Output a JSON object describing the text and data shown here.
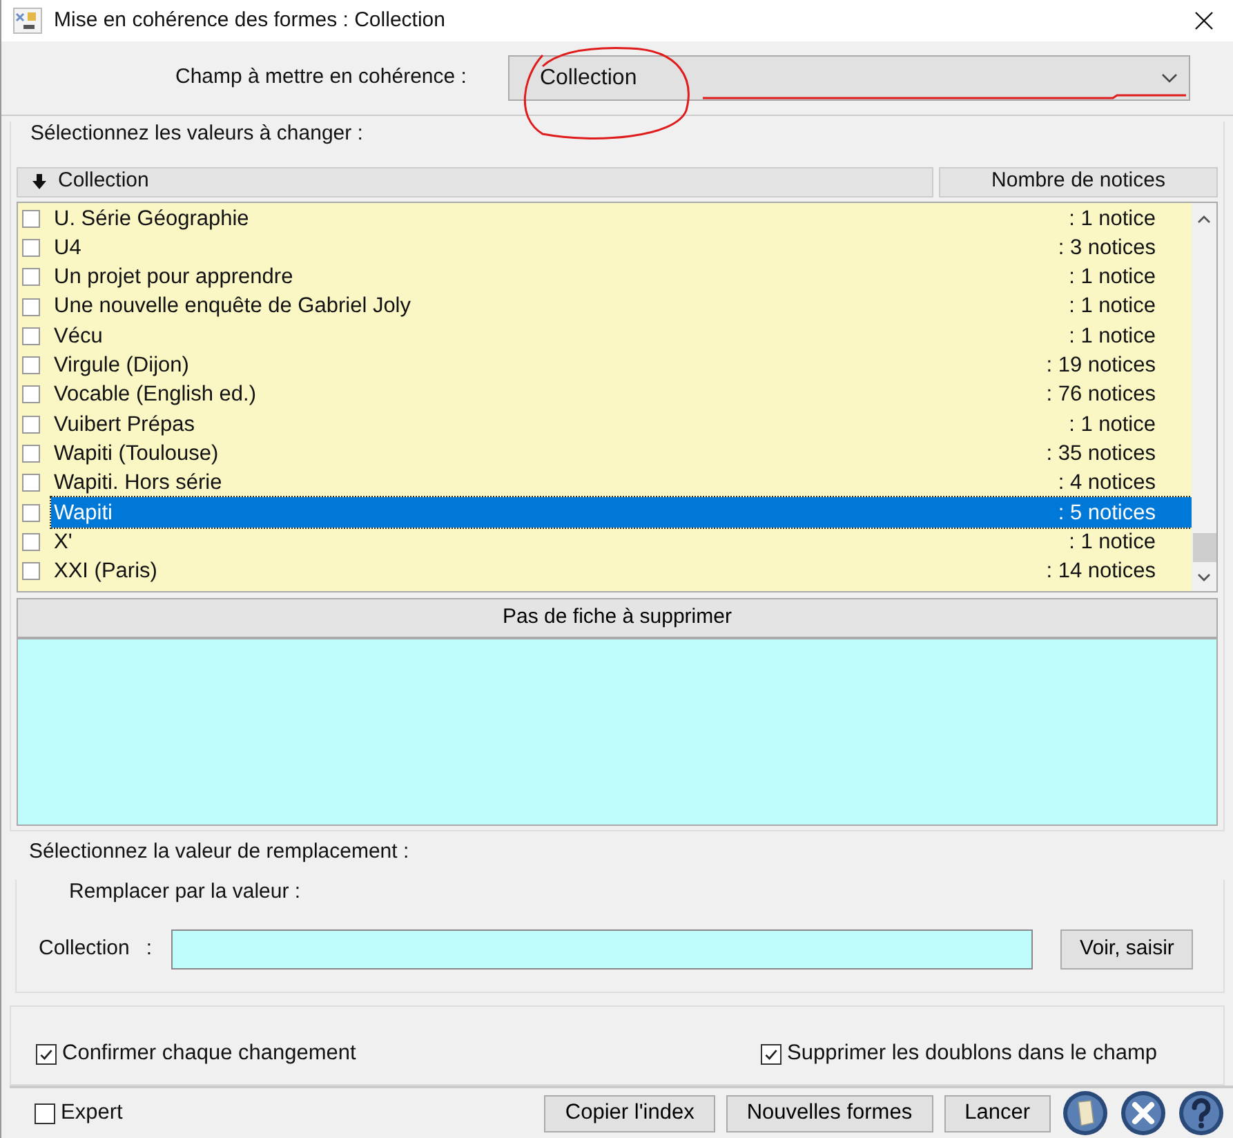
{
  "window": {
    "title": "Mise en cohérence des formes :  Collection"
  },
  "field_selector": {
    "label": "Champ à mettre en cohérence :",
    "value": "Collection"
  },
  "values_group": {
    "title": "Sélectionnez les valeurs à changer :",
    "columns": [
      "Collection",
      "Nombre de notices"
    ],
    "rows": [
      {
        "label": "U. Série Géographie",
        "count": ": 1 notice",
        "checked": false,
        "selected": false
      },
      {
        "label": "U4",
        "count": ": 3 notices",
        "checked": false,
        "selected": false
      },
      {
        "label": "Un projet pour apprendre",
        "count": ": 1 notice",
        "checked": false,
        "selected": false
      },
      {
        "label": "Une nouvelle enquête de Gabriel Joly",
        "count": ": 1 notice",
        "checked": false,
        "selected": false
      },
      {
        "label": "Vécu",
        "count": ": 1 notice",
        "checked": false,
        "selected": false
      },
      {
        "label": "Virgule (Dijon)",
        "count": ": 19 notices",
        "checked": false,
        "selected": false
      },
      {
        "label": "Vocable (English ed.)",
        "count": ": 76 notices",
        "checked": false,
        "selected": false
      },
      {
        "label": "Vuibert Prépas",
        "count": ": 1 notice",
        "checked": false,
        "selected": false
      },
      {
        "label": "Wapiti (Toulouse)",
        "count": ": 35 notices",
        "checked": false,
        "selected": false
      },
      {
        "label": "Wapiti. Hors série",
        "count": ": 4 notices",
        "checked": false,
        "selected": false
      },
      {
        "label": "Wapiti",
        "count": ": 5 notices",
        "checked": false,
        "selected": true
      },
      {
        "label": "X'",
        "count": ": 1 notice",
        "checked": false,
        "selected": false
      },
      {
        "label": "XXI (Paris)",
        "count": ": 14 notices",
        "checked": false,
        "selected": false
      }
    ],
    "delete_button": "Pas de fiche à supprimer"
  },
  "replacement": {
    "title": "Sélectionnez la valeur de remplacement :",
    "subtitle": "Remplacer par la valeur :",
    "field_label": "Collection",
    "colon": ":",
    "button": "Voir, saisir"
  },
  "options": [
    {
      "label": "Confirmer chaque changement",
      "checked": true
    },
    {
      "label": "Supprimer les doublons dans le champ",
      "checked": true
    }
  ],
  "footer": {
    "expert": {
      "label": "Expert",
      "checked": false
    },
    "buttons": [
      "Copier l'index",
      "Nouvelles formes",
      "Lancer"
    ]
  }
}
